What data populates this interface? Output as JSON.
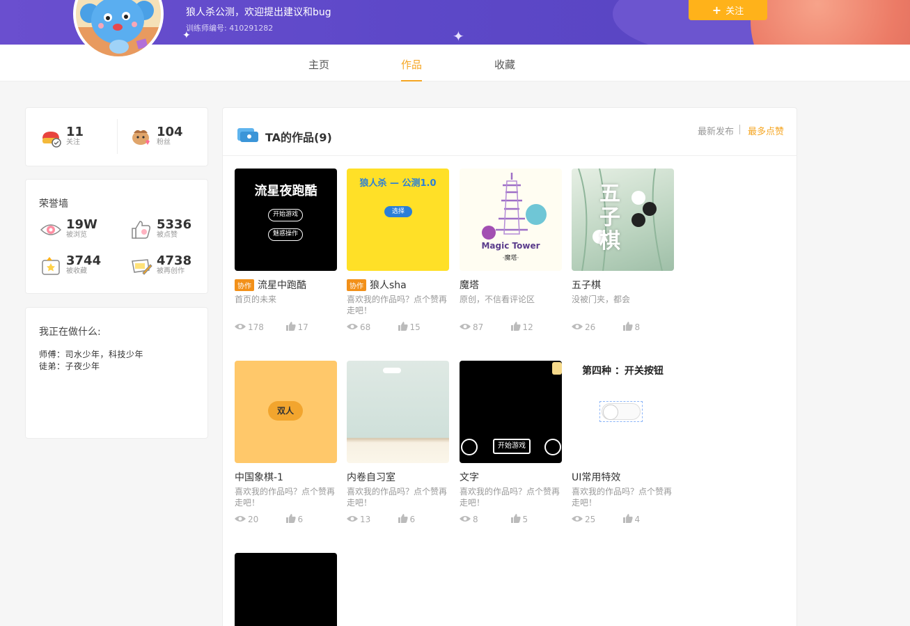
{
  "header": {
    "user_name": "狼人杀公测，欢迎提出建议和bug",
    "trainer_id": "训练师编号: 410291282",
    "follow_label": "关注",
    "follow_icon": "plus-icon"
  },
  "tabs": [
    {
      "label": "主页"
    },
    {
      "label": "作品",
      "active": true
    },
    {
      "label": "收藏"
    }
  ],
  "social": {
    "following": {
      "value": "11",
      "label": "关注"
    },
    "followers": {
      "value": "104",
      "label": "粉丝"
    }
  },
  "honor": {
    "title": "荣誉墙",
    "items": [
      {
        "value": "19W",
        "label": "被浏览",
        "icon": "eye-icon"
      },
      {
        "value": "5336",
        "label": "被点赞",
        "icon": "thumb-icon"
      },
      {
        "value": "3744",
        "label": "被收藏",
        "icon": "star-box-icon"
      },
      {
        "value": "4738",
        "label": "被再创作",
        "icon": "edit-icon"
      }
    ]
  },
  "doing": {
    "title": "我正在做什么:",
    "lines": [
      "师傅：司水少年，科技少年",
      "徒弟：子夜少年"
    ]
  },
  "works": {
    "title": "TA的作品(9)",
    "sort_latest": "最新发布",
    "sort_popular": "最多点赞",
    "accent": "#f5a623",
    "collab_label": "协作",
    "items": [
      {
        "name": "流星中跑酷",
        "collab": true,
        "desc": "首页的未来",
        "views": "178",
        "likes": "17",
        "thumb": {
          "bg": "#000",
          "title": "流星夜跑酷",
          "btn1": "开始游戏",
          "btn2": "魅惑操作"
        }
      },
      {
        "name": "狼人sha",
        "collab": true,
        "desc": "喜欢我的作品吗？点个赞再走吧！",
        "views": "68",
        "likes": "15",
        "thumb": {
          "bg": "#ffe027",
          "title": "狼人杀 — 公测1.0",
          "btn1": "选择"
        }
      },
      {
        "name": "魔塔",
        "collab": false,
        "desc": "原创，不信看评论区",
        "views": "87",
        "likes": "12",
        "thumb": {
          "bg": "#fffdf2",
          "title": "Magic Tower",
          "sub": "·魔塔·"
        }
      },
      {
        "name": "五子棋",
        "collab": false,
        "desc": "没被门夹，都会",
        "views": "26",
        "likes": "8",
        "thumb": {
          "bg": "#cfe0d2",
          "title": "五子棋"
        }
      },
      {
        "name": "中国象棋-1",
        "collab": false,
        "desc": "喜欢我的作品吗？点个赞再走吧！",
        "views": "20",
        "likes": "6",
        "thumb": {
          "bg": "#ffc86a",
          "btn1": "双人"
        }
      },
      {
        "name": "内卷自习室",
        "collab": false,
        "desc": "喜欢我的作品吗？点个赞再走吧！",
        "views": "13",
        "likes": "6",
        "thumb": {
          "bg": "#d9e6df"
        }
      },
      {
        "name": "文字",
        "collab": false,
        "desc": "喜欢我的作品吗？点个赞再走吧！",
        "views": "8",
        "likes": "5",
        "thumb": {
          "bg": "#000",
          "btn1": "开始游戏"
        }
      },
      {
        "name": "UI常用特效",
        "collab": false,
        "desc": "喜欢我的作品吗？点个赞再走吧！",
        "views": "25",
        "likes": "4",
        "thumb": {
          "bg": "#fff",
          "title": "第四种 ：开关按钮"
        }
      },
      {
        "name": "",
        "collab": false,
        "desc": "",
        "views": "",
        "likes": "",
        "thumb": {
          "bg": "#000"
        }
      }
    ]
  }
}
